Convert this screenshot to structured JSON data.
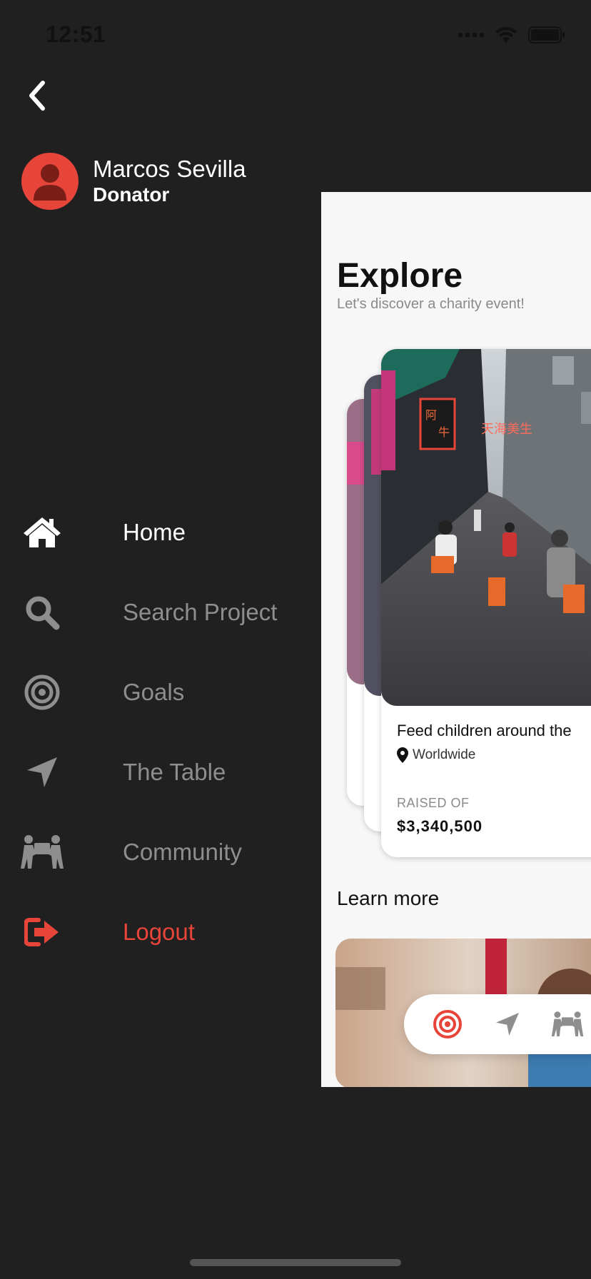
{
  "status_bar": {
    "time": "12:51"
  },
  "drawer": {
    "back_icon": "chevron-left-icon",
    "profile": {
      "name": "Marcos Sevilla",
      "role": "Donator",
      "avatar_icon": "user-icon"
    },
    "menu": [
      {
        "label": "Home",
        "icon": "home-icon",
        "active": true
      },
      {
        "label": "Search Project",
        "icon": "search-icon"
      },
      {
        "label": "Goals",
        "icon": "target-icon"
      },
      {
        "label": "The Table",
        "icon": "location-arrow-icon"
      },
      {
        "label": "Community",
        "icon": "people-carry-icon"
      },
      {
        "label": "Logout",
        "icon": "sign-out-icon",
        "danger": true
      }
    ]
  },
  "main": {
    "title": "Explore",
    "subtitle": "Let's discover a charity event!",
    "featured_card": {
      "title": "Feed children around the",
      "location": "Worldwide",
      "raised_label": "RAISED OF",
      "raised_value": "$3,340,500"
    },
    "learn_more": "Learn more",
    "bottom_nav": [
      "target-icon",
      "location-arrow-icon",
      "people-carry-icon"
    ]
  },
  "colors": {
    "background": "#202020",
    "accent": "#e8453a",
    "muted": "#8e8e8e"
  }
}
